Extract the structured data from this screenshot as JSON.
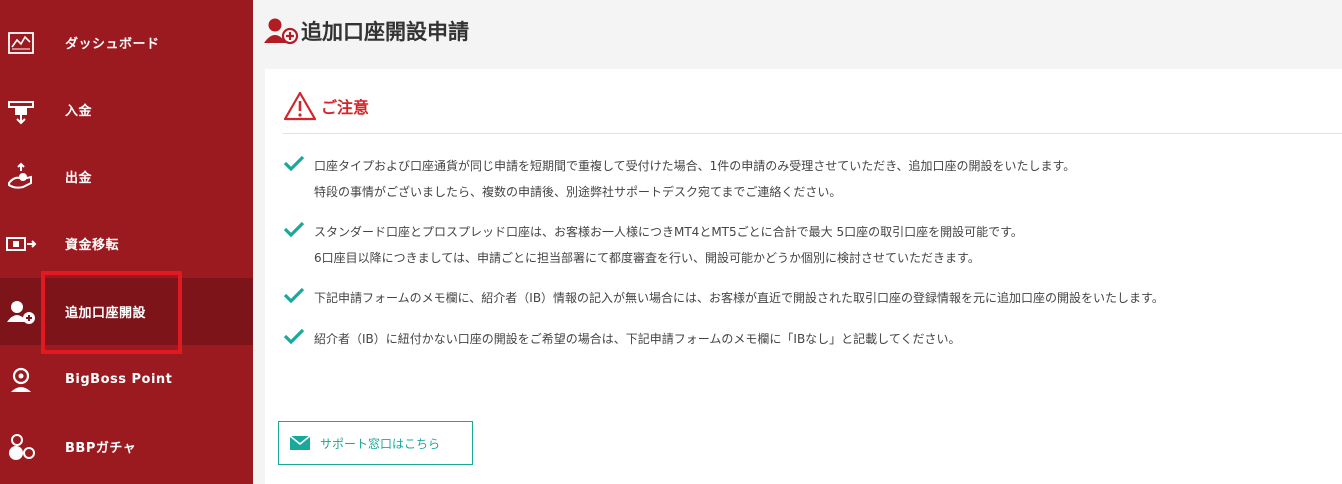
{
  "sidebar": {
    "items": [
      {
        "label": "ダッシュボード",
        "icon": "dashboard-chart-icon"
      },
      {
        "label": "入金",
        "icon": "deposit-icon"
      },
      {
        "label": "出金",
        "icon": "withdraw-icon"
      },
      {
        "label": "資金移転",
        "icon": "transfer-icon"
      },
      {
        "label": "追加口座開設",
        "icon": "add-account-icon",
        "active": true
      },
      {
        "label": "BigBoss Point",
        "icon": "point-icon"
      },
      {
        "label": "BBPガチャ",
        "icon": "gacha-icon"
      }
    ]
  },
  "header": {
    "title": "追加口座開設申請"
  },
  "notice": {
    "title": "ご注意",
    "items": [
      {
        "lines": [
          "口座タイプおよび口座通貨が同じ申請を短期間で重複して受付けた場合、1件の申請のみ受理させていただき、追加口座の開設をいたします。",
          "特段の事情がございましたら、複数の申請後、別途弊社サポートデスク宛てまでご連絡ください。"
        ]
      },
      {
        "lines": [
          "スタンダード口座とプロスプレッド口座は、お客様お一人様につきMT4とMT5ごとに合計で最大 5口座の取引口座を開設可能です。",
          "6口座目以降につきましては、申請ごとに担当部署にて都度審査を行い、開設可能かどうか個別に検討させていただきます。"
        ]
      },
      {
        "lines": [
          "下記申請フォームのメモ欄に、紹介者（IB）情報の記入が無い場合には、お客様が直近で開設された取引口座の登録情報を元に追加口座の開設をいたします。"
        ]
      },
      {
        "lines": [
          "紹介者（IB）に紐付かない口座の開設をご希望の場合は、下記申請フォームのメモ欄に「IBなし」と記載してください。"
        ]
      }
    ]
  },
  "support_button": {
    "label": "サポート窓口はこちら"
  },
  "colors": {
    "sidebar": "#9a1a1f",
    "sidebar_active": "#7c1419",
    "accent_red": "#d5242a",
    "teal": "#1aa89a",
    "highlight": "#e11a22"
  }
}
